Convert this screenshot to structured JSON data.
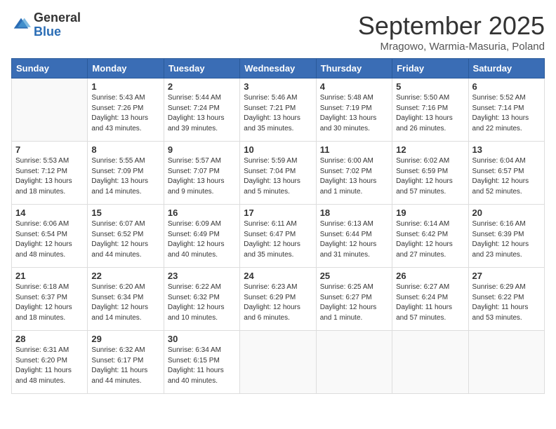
{
  "logo": {
    "general": "General",
    "blue": "Blue"
  },
  "header": {
    "month": "September 2025",
    "location": "Mragowo, Warmia-Masuria, Poland"
  },
  "days_of_week": [
    "Sunday",
    "Monday",
    "Tuesday",
    "Wednesday",
    "Thursday",
    "Friday",
    "Saturday"
  ],
  "weeks": [
    [
      {
        "day": null
      },
      {
        "day": "1",
        "sunrise": "5:43 AM",
        "sunset": "7:26 PM",
        "daylight": "13 hours and 43 minutes."
      },
      {
        "day": "2",
        "sunrise": "5:44 AM",
        "sunset": "7:24 PM",
        "daylight": "13 hours and 39 minutes."
      },
      {
        "day": "3",
        "sunrise": "5:46 AM",
        "sunset": "7:21 PM",
        "daylight": "13 hours and 35 minutes."
      },
      {
        "day": "4",
        "sunrise": "5:48 AM",
        "sunset": "7:19 PM",
        "daylight": "13 hours and 30 minutes."
      },
      {
        "day": "5",
        "sunrise": "5:50 AM",
        "sunset": "7:16 PM",
        "daylight": "13 hours and 26 minutes."
      },
      {
        "day": "6",
        "sunrise": "5:52 AM",
        "sunset": "7:14 PM",
        "daylight": "13 hours and 22 minutes."
      }
    ],
    [
      {
        "day": "7",
        "sunrise": "5:53 AM",
        "sunset": "7:12 PM",
        "daylight": "13 hours and 18 minutes."
      },
      {
        "day": "8",
        "sunrise": "5:55 AM",
        "sunset": "7:09 PM",
        "daylight": "13 hours and 14 minutes."
      },
      {
        "day": "9",
        "sunrise": "5:57 AM",
        "sunset": "7:07 PM",
        "daylight": "13 hours and 9 minutes."
      },
      {
        "day": "10",
        "sunrise": "5:59 AM",
        "sunset": "7:04 PM",
        "daylight": "13 hours and 5 minutes."
      },
      {
        "day": "11",
        "sunrise": "6:00 AM",
        "sunset": "7:02 PM",
        "daylight": "13 hours and 1 minute."
      },
      {
        "day": "12",
        "sunrise": "6:02 AM",
        "sunset": "6:59 PM",
        "daylight": "12 hours and 57 minutes."
      },
      {
        "day": "13",
        "sunrise": "6:04 AM",
        "sunset": "6:57 PM",
        "daylight": "12 hours and 52 minutes."
      }
    ],
    [
      {
        "day": "14",
        "sunrise": "6:06 AM",
        "sunset": "6:54 PM",
        "daylight": "12 hours and 48 minutes."
      },
      {
        "day": "15",
        "sunrise": "6:07 AM",
        "sunset": "6:52 PM",
        "daylight": "12 hours and 44 minutes."
      },
      {
        "day": "16",
        "sunrise": "6:09 AM",
        "sunset": "6:49 PM",
        "daylight": "12 hours and 40 minutes."
      },
      {
        "day": "17",
        "sunrise": "6:11 AM",
        "sunset": "6:47 PM",
        "daylight": "12 hours and 35 minutes."
      },
      {
        "day": "18",
        "sunrise": "6:13 AM",
        "sunset": "6:44 PM",
        "daylight": "12 hours and 31 minutes."
      },
      {
        "day": "19",
        "sunrise": "6:14 AM",
        "sunset": "6:42 PM",
        "daylight": "12 hours and 27 minutes."
      },
      {
        "day": "20",
        "sunrise": "6:16 AM",
        "sunset": "6:39 PM",
        "daylight": "12 hours and 23 minutes."
      }
    ],
    [
      {
        "day": "21",
        "sunrise": "6:18 AM",
        "sunset": "6:37 PM",
        "daylight": "12 hours and 18 minutes."
      },
      {
        "day": "22",
        "sunrise": "6:20 AM",
        "sunset": "6:34 PM",
        "daylight": "12 hours and 14 minutes."
      },
      {
        "day": "23",
        "sunrise": "6:22 AM",
        "sunset": "6:32 PM",
        "daylight": "12 hours and 10 minutes."
      },
      {
        "day": "24",
        "sunrise": "6:23 AM",
        "sunset": "6:29 PM",
        "daylight": "12 hours and 6 minutes."
      },
      {
        "day": "25",
        "sunrise": "6:25 AM",
        "sunset": "6:27 PM",
        "daylight": "12 hours and 1 minute."
      },
      {
        "day": "26",
        "sunrise": "6:27 AM",
        "sunset": "6:24 PM",
        "daylight": "11 hours and 57 minutes."
      },
      {
        "day": "27",
        "sunrise": "6:29 AM",
        "sunset": "6:22 PM",
        "daylight": "11 hours and 53 minutes."
      }
    ],
    [
      {
        "day": "28",
        "sunrise": "6:31 AM",
        "sunset": "6:20 PM",
        "daylight": "11 hours and 48 minutes."
      },
      {
        "day": "29",
        "sunrise": "6:32 AM",
        "sunset": "6:17 PM",
        "daylight": "11 hours and 44 minutes."
      },
      {
        "day": "30",
        "sunrise": "6:34 AM",
        "sunset": "6:15 PM",
        "daylight": "11 hours and 40 minutes."
      },
      {
        "day": null
      },
      {
        "day": null
      },
      {
        "day": null
      },
      {
        "day": null
      }
    ]
  ]
}
